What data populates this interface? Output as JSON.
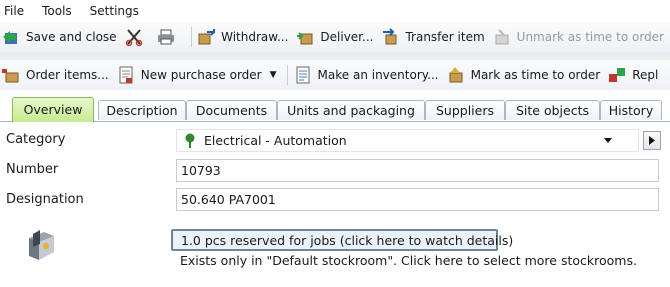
{
  "menu": [
    "File",
    "Tools",
    "Settings"
  ],
  "toolbar1": [
    {
      "label": "Save and close",
      "icon": "save-close-icon"
    },
    {
      "label": "",
      "icon": "cut-icon"
    },
    {
      "label": "",
      "icon": "print-icon"
    },
    {
      "label": "Withdraw...",
      "icon": "withdraw-icon"
    },
    {
      "label": "Deliver...",
      "icon": "deliver-icon"
    },
    {
      "label": "Transfer item",
      "icon": "transfer-icon"
    },
    {
      "label": "Unmark as time to order",
      "icon": "unmark-icon",
      "disabled": true
    }
  ],
  "toolbar2": [
    {
      "label": "Order items...",
      "icon": "order-items-icon"
    },
    {
      "label": "New purchase order",
      "icon": "purchase-order-icon",
      "dropdown": true
    },
    {
      "label": "Make an inventory...",
      "icon": "inventory-icon"
    },
    {
      "label": "Mark as time to order",
      "icon": "mark-order-icon"
    },
    {
      "label": "Repl",
      "icon": "replace-icon"
    }
  ],
  "tabs": [
    "Overview",
    "Description",
    "Documents",
    "Units and packaging",
    "Suppliers",
    "Site objects",
    "History"
  ],
  "active_tab": "Overview",
  "form": {
    "category_label": "Category",
    "category_value": "Electrical - Automation",
    "number_label": "Number",
    "number_value": "10793",
    "designation_label": "Designation",
    "designation_value": "50.640 PA7001"
  },
  "reserved_text": "1.0 pcs reserved for jobs (click here to watch details)",
  "stockroom_text": "Exists only in \"Default stockroom\". Click here to select more stockrooms.",
  "colors": {
    "active_tab": "#c7ea8e",
    "reserved_border": "#6f8696",
    "category_pin": "#2f8a2f"
  }
}
